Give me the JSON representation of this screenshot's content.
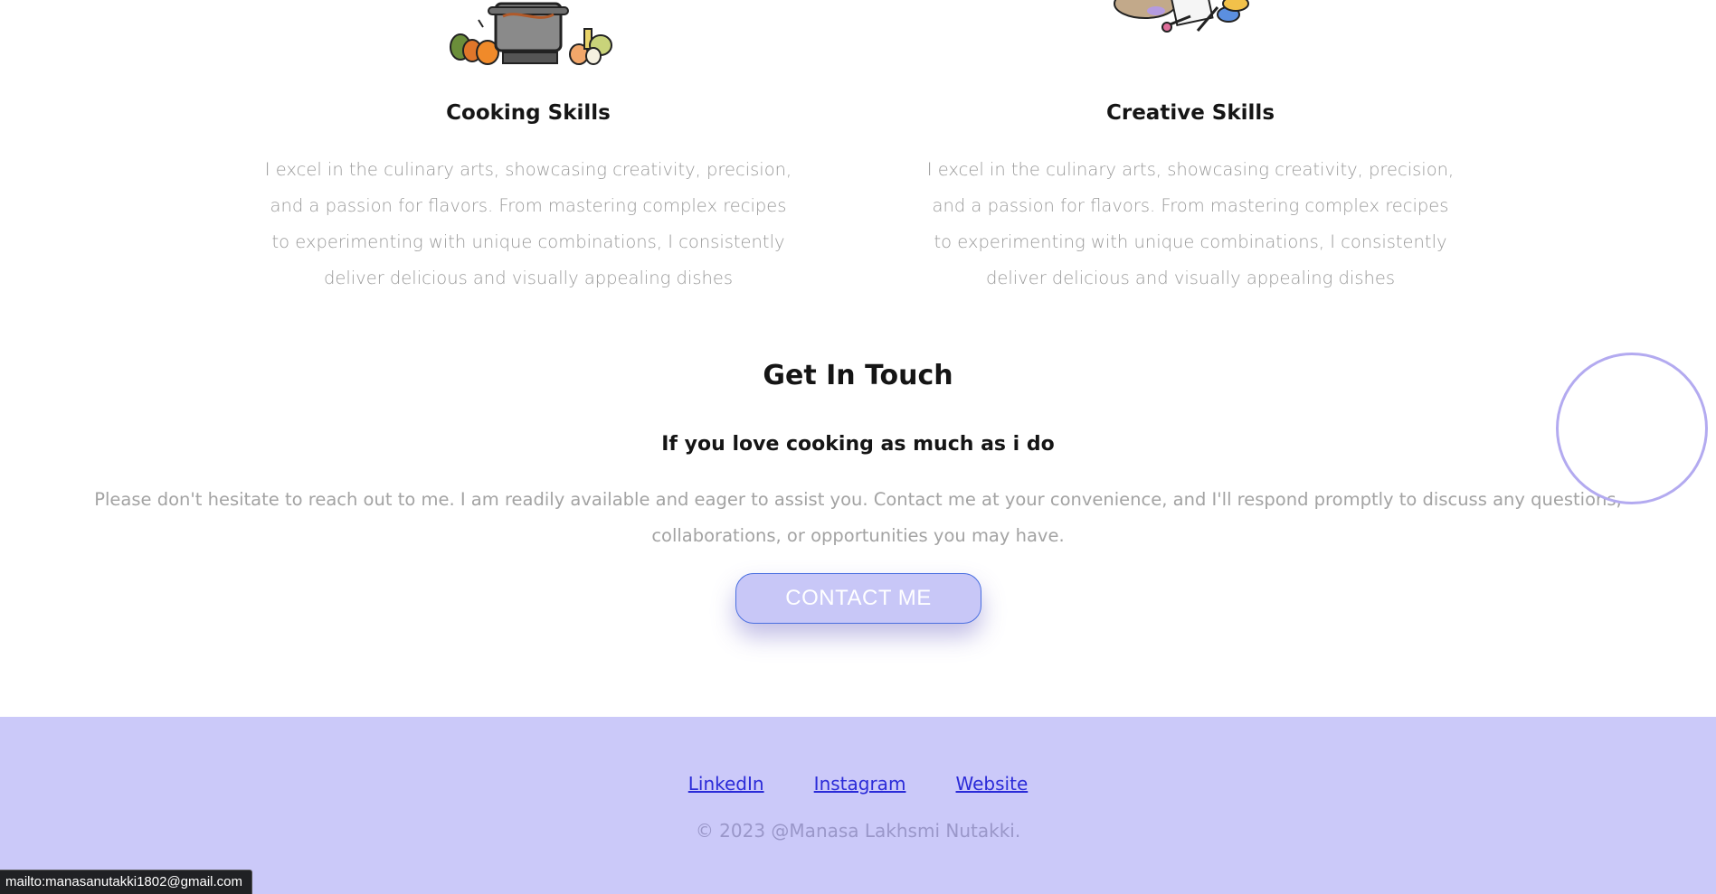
{
  "skills": [
    {
      "title": "Cooking Skills",
      "illustration_icon": "cooking-pot-icon",
      "description": "I excel in the culinary arts, showcasing creativity, precision, and a passion for flavors. From mastering complex recipes to experimenting with unique combinations, I consistently deliver delicious and visually appealing dishes"
    },
    {
      "title": "Creative Skills",
      "illustration_icon": "art-supplies-icon",
      "description": "I excel in the culinary arts, showcasing creativity, precision, and a passion for flavors. From mastering complex recipes to experimenting with unique combinations, I consistently deliver delicious and visually appealing dishes"
    }
  ],
  "contact": {
    "title": "Get In Touch",
    "subtitle": "If you love cooking as much as i do",
    "description": "Please don't hesitate to reach out to me. I am readily available and eager to assist you. Contact me at your convenience, and I'll respond promptly to discuss any questions, collaborations, or opportunities you may have.",
    "button_label": "CONTACT ME"
  },
  "footer": {
    "links": [
      "LinkedIn",
      "Instagram",
      "Website"
    ],
    "copyright": "© 2023 @Manasa Lakhsmi Nutakki."
  },
  "status_bar": {
    "url": "mailto:manasanutakki1802@gmail.com"
  },
  "colors": {
    "accent": "#cbc9f9",
    "button_bg": "#c8c7f7",
    "button_border": "#4a6fe0",
    "link": "#2b2bd8",
    "muted_text": "#9a9a9a",
    "cursor_ring": "#b3aaf0"
  }
}
